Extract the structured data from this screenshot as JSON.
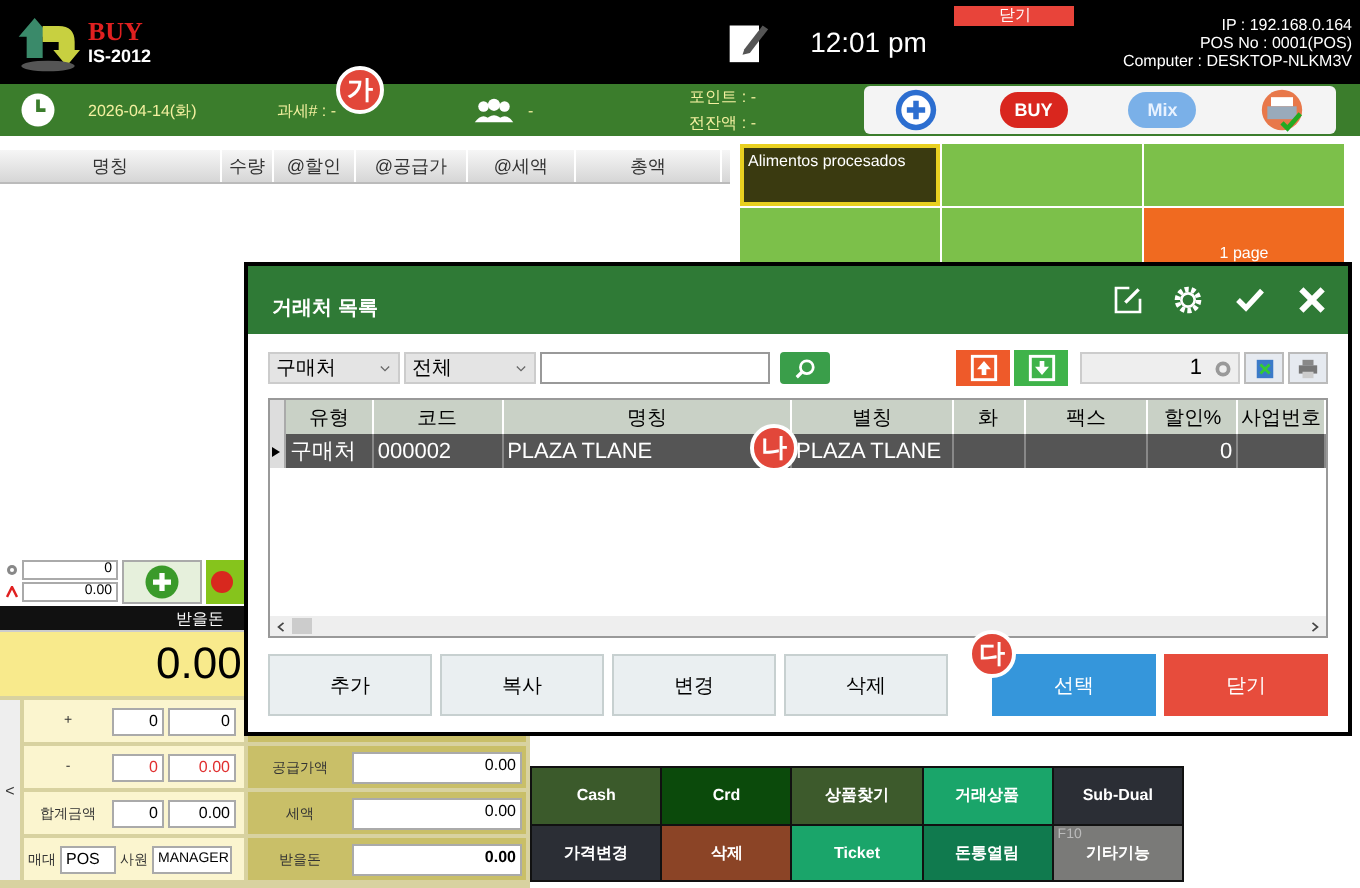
{
  "header": {
    "logo_title": "BUY",
    "logo_subtitle": "IS-2012",
    "time": "12:01 pm",
    "close_button": "닫기",
    "info": [
      "IP : 192.168.0.164",
      "POS No : 0001(POS)",
      "Computer : DESKTOP-NLKM3V"
    ]
  },
  "info_bar": {
    "date": "2026-04-14(화)",
    "tax_no": "과세# :  -",
    "badge": "가",
    "customer": "-",
    "points": "포인트 : -",
    "balance": "전잔액 : -",
    "buttons": [
      {
        "kind": "add"
      },
      {
        "kind": "buy",
        "label": "BUY"
      },
      {
        "kind": "mix",
        "label": "Mix"
      },
      {
        "kind": "print"
      }
    ]
  },
  "order_table": {
    "columns": [
      "명칭",
      "수량",
      "@할인",
      "@공급가",
      "@세액",
      "총액"
    ]
  },
  "category_tiles": [
    {
      "kind": "category",
      "label": "Alimentos procesados",
      "selected": true
    },
    {
      "kind": "blank",
      "selected": false
    },
    {
      "kind": "blank",
      "selected": false
    },
    {
      "kind": "blank",
      "selected": false
    },
    {
      "kind": "blank",
      "selected": false
    },
    {
      "kind": "page",
      "label": "1 page",
      "selected": false
    }
  ],
  "entry": {
    "quantity": "0",
    "amount": "0.00"
  },
  "due": {
    "label": "받을돈",
    "amount": "0.00"
  },
  "totals_left": [
    {
      "label": "+",
      "quantity": "0",
      "amount": "0",
      "negative": false
    },
    {
      "label": "-",
      "quantity": "0",
      "amount": "0.00",
      "negative": true
    },
    {
      "label": "합계금액",
      "quantity": "0",
      "amount": "0.00",
      "negative": false
    }
  ],
  "collapse_arrow": "<",
  "staff": {
    "counter_label": "매대",
    "counter": "POS",
    "staff_label": "사원",
    "staff": "MANAGER"
  },
  "totals_right": [
    {
      "kind": "normal",
      "label": "공급가액",
      "value": "0.00"
    },
    {
      "kind": "normal",
      "label": "세액",
      "value": "0.00"
    },
    {
      "kind": "total",
      "label": "받을돈",
      "value": "0.00"
    }
  ],
  "action_buttons": [
    {
      "label": "Cash",
      "color": "#3b5a2b"
    },
    {
      "label": "Crd",
      "color": "#0b4a0b"
    },
    {
      "label": "상품찾기",
      "color": "#3d5a2c"
    },
    {
      "label": "거래상품",
      "color": "#1aa56a"
    },
    {
      "label": "Sub-Dual",
      "color": "#2b2e35"
    },
    {
      "label": "가격변경",
      "color": "#2b2e35"
    },
    {
      "label": "삭제",
      "color": "#8b4426"
    },
    {
      "label": "Ticket",
      "color": "#1aa56a"
    },
    {
      "label": "돈통열림",
      "color": "#107a4e"
    },
    {
      "label": "기타기능",
      "hotkey": "F10",
      "color": "#7a7a78"
    }
  ],
  "dialog": {
    "title": "거래처 목록",
    "type_filter": "구매처",
    "scope_filter": "전체",
    "page": "1",
    "columns": [
      "유형",
      "코드",
      "명칭",
      "별칭",
      "화",
      "팩스",
      "할인%",
      "사업번호"
    ],
    "rows": [
      {
        "cells": [
          "구매처",
          "000002",
          "PLAZA TLANE",
          "PLAZA TLANE",
          null,
          null,
          "0",
          null
        ],
        "selected": true
      }
    ],
    "row_badge": "나",
    "buttons": [
      "추가",
      "복사",
      "변경",
      "삭제"
    ],
    "confirm_badge": "다",
    "confirm": "선택",
    "close": "닫기"
  }
}
